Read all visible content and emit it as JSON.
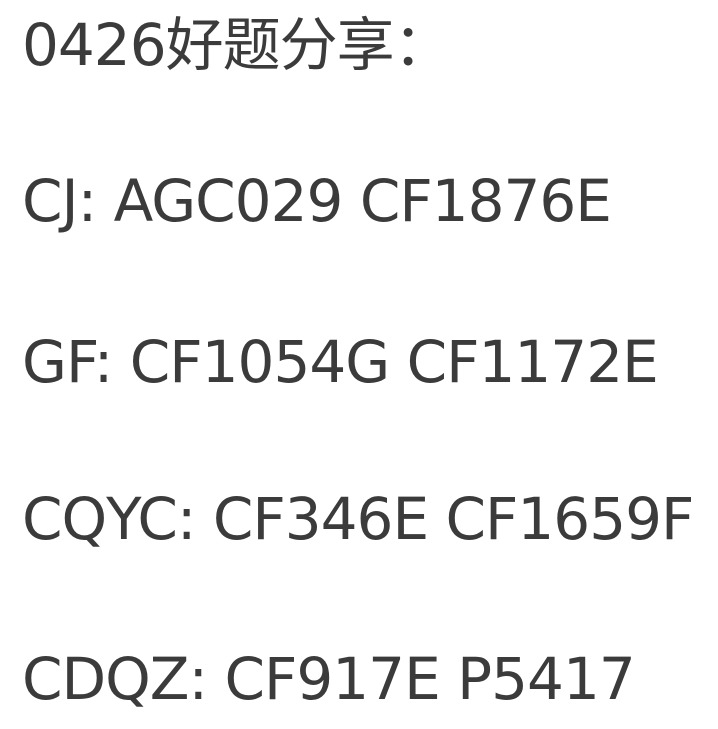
{
  "document": {
    "heading": "0426好题分享：",
    "lines": [
      "CJ: AGC029 CF1876E",
      "GF: CF1054G CF1172E",
      "CQYC: CF346E CF1659F",
      "CDQZ: CF917E P5417"
    ]
  }
}
